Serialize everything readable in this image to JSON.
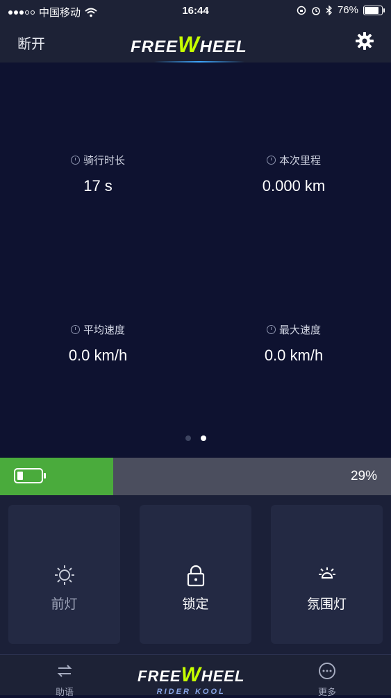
{
  "status_bar": {
    "carrier": "中国移动",
    "time": "16:44",
    "battery_percent": "76%",
    "battery_level": 0.76
  },
  "header": {
    "disconnect_label": "断开",
    "logo": "FREEWHEEL",
    "logo_parts": [
      "FREE",
      "W",
      "HEEL"
    ]
  },
  "stats": [
    {
      "icon": "clock-icon",
      "label": "骑行时长",
      "value": "17 s"
    },
    {
      "icon": "odometer-icon",
      "label": "本次里程",
      "value": "0.000 km"
    },
    {
      "icon": "speed-icon",
      "label": "平均速度",
      "value": "0.0 km/h"
    },
    {
      "icon": "max-speed-icon",
      "label": "最大速度",
      "value": "0.0 km/h"
    }
  ],
  "pager": {
    "total": 2,
    "active": 2
  },
  "battery": {
    "percent_label": "29%",
    "level": 0.29
  },
  "controls": [
    {
      "icon": "sun-icon",
      "label": "前灯",
      "active": false
    },
    {
      "icon": "lock-icon",
      "label": "锁定",
      "active": true
    },
    {
      "icon": "sun-icon",
      "label": "氛围灯",
      "active": true
    }
  ],
  "tab_bar": {
    "left_label": "助语",
    "right_label": "更多",
    "logo_parts": [
      "FREE",
      "W",
      "HEEL"
    ],
    "logo_sub": "RIDER KOOL"
  },
  "colors": {
    "accent_green": "#4aab3c",
    "logo_green": "#c6ff00",
    "background": "#0e1230",
    "glow_blue": "#3fa8ff"
  }
}
